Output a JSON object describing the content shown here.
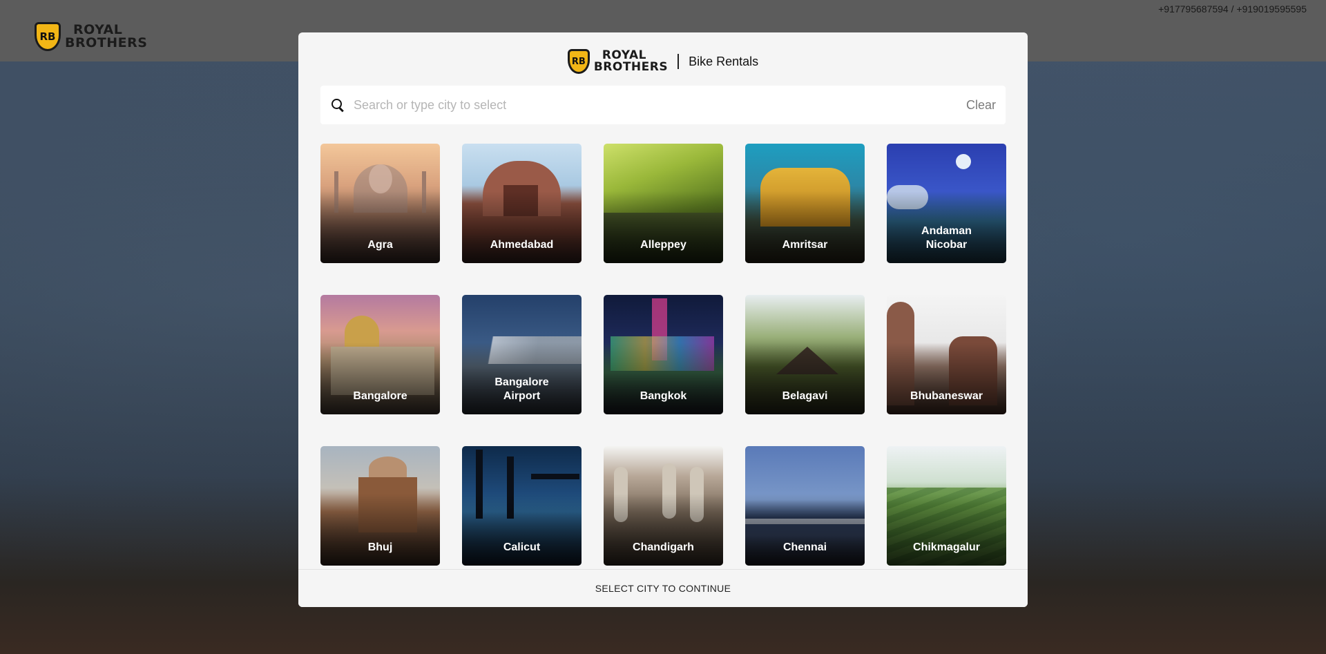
{
  "page": {
    "phones": "+917795687594 / +919019595595",
    "logo_line1": "ROYAL",
    "logo_line2": "BROTHERS",
    "logo_badge": "RB"
  },
  "modal": {
    "brand_line1": "ROYAL",
    "brand_line2": "BROTHERS",
    "brand_badge": "RB",
    "brand_sub": "Bike Rentals",
    "search_placeholder": "Search or type city to select",
    "search_value": "",
    "clear_label": "Clear",
    "footer_label": "SELECT CITY TO CONTINUE"
  },
  "cities": [
    {
      "name": "Agra"
    },
    {
      "name": "Ahmedabad"
    },
    {
      "name": "Alleppey"
    },
    {
      "name": "Amritsar"
    },
    {
      "name": "Andaman Nicobar"
    },
    {
      "name": "Bangalore"
    },
    {
      "name": "Bangalore Airport"
    },
    {
      "name": "Bangkok"
    },
    {
      "name": "Belagavi"
    },
    {
      "name": "Bhubaneswar"
    },
    {
      "name": "Bhuj"
    },
    {
      "name": "Calicut"
    },
    {
      "name": "Chandigarh"
    },
    {
      "name": "Chennai"
    },
    {
      "name": "Chikmagalur"
    }
  ],
  "colors": {
    "accent": "#f2b616",
    "modal_bg": "#f5f5f5",
    "overlay": "#3c4147"
  }
}
